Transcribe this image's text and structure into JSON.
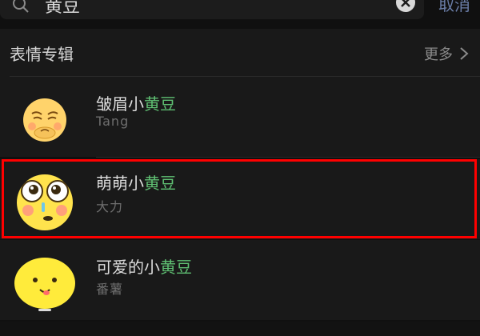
{
  "search": {
    "query": "黄豆",
    "cancel_label": "取消"
  },
  "section": {
    "title": "表情专辑",
    "more_label": "更多"
  },
  "results": [
    {
      "name_prefix": "皱眉小",
      "name_highlight": "黄豆",
      "author": "Tang"
    },
    {
      "name_prefix": "萌萌小",
      "name_highlight": "黄豆",
      "author": "大力"
    },
    {
      "name_prefix": "可爱的小",
      "name_highlight": "黄豆",
      "author": "番薯"
    }
  ],
  "colors": {
    "background": "#101010",
    "panel": "#191919",
    "highlight_text": "#5fbf72",
    "annotation_box": "#ff0000",
    "cancel_link": "#6b7ea8"
  },
  "icons": {
    "search": "search-icon",
    "clear": "clear-icon",
    "more": "chevron-right-icon"
  }
}
